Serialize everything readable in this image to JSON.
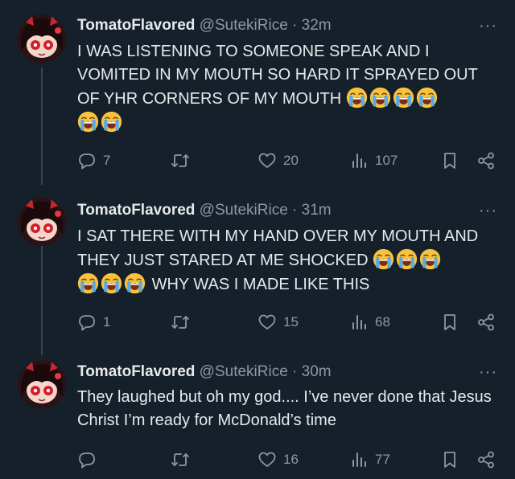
{
  "tweets": [
    {
      "name": "TomatoFlavored",
      "handle": "@SutekiRice",
      "time": "32m",
      "text": "I WAS LISTENING TO SOMEONE SPEAK AND I VOMITED IN MY MOUTH SO HARD IT SPRAYED OUT OF YHR CORNERS OF MY MOUTH",
      "replies": "7",
      "retweets": "",
      "likes": "20",
      "views": "107"
    },
    {
      "name": "TomatoFlavored",
      "handle": "@SutekiRice",
      "time": "31m",
      "text": "I SAT THERE WITH MY HAND OVER MY MOUTH AND THEY JUST STARED AT ME SHOCKED",
      "text2": "WHY WAS I MADE LIKE THIS",
      "replies": "1",
      "retweets": "",
      "likes": "15",
      "views": "68"
    },
    {
      "name": "TomatoFlavored",
      "handle": "@SutekiRice",
      "time": "30m",
      "text": "They laughed but oh my god.... I’ve never done that Jesus Christ I’m ready for McDonald’s time",
      "replies": "",
      "retweets": "",
      "likes": "16",
      "views": "77"
    }
  ],
  "separator": " · ",
  "more_label": "···",
  "icons": {
    "avatar": "anime-avatar",
    "emoji": "loudly-crying-face-emoji",
    "reply": "reply-icon",
    "retweet": "retweet-icon",
    "like": "heart-icon",
    "views": "views-icon",
    "bookmark": "bookmark-icon",
    "share": "share-icon"
  },
  "colors": {
    "background": "#15202b",
    "text": "#e7e9ea",
    "muted": "#8b98a5",
    "thread_line": "#3a4550"
  }
}
